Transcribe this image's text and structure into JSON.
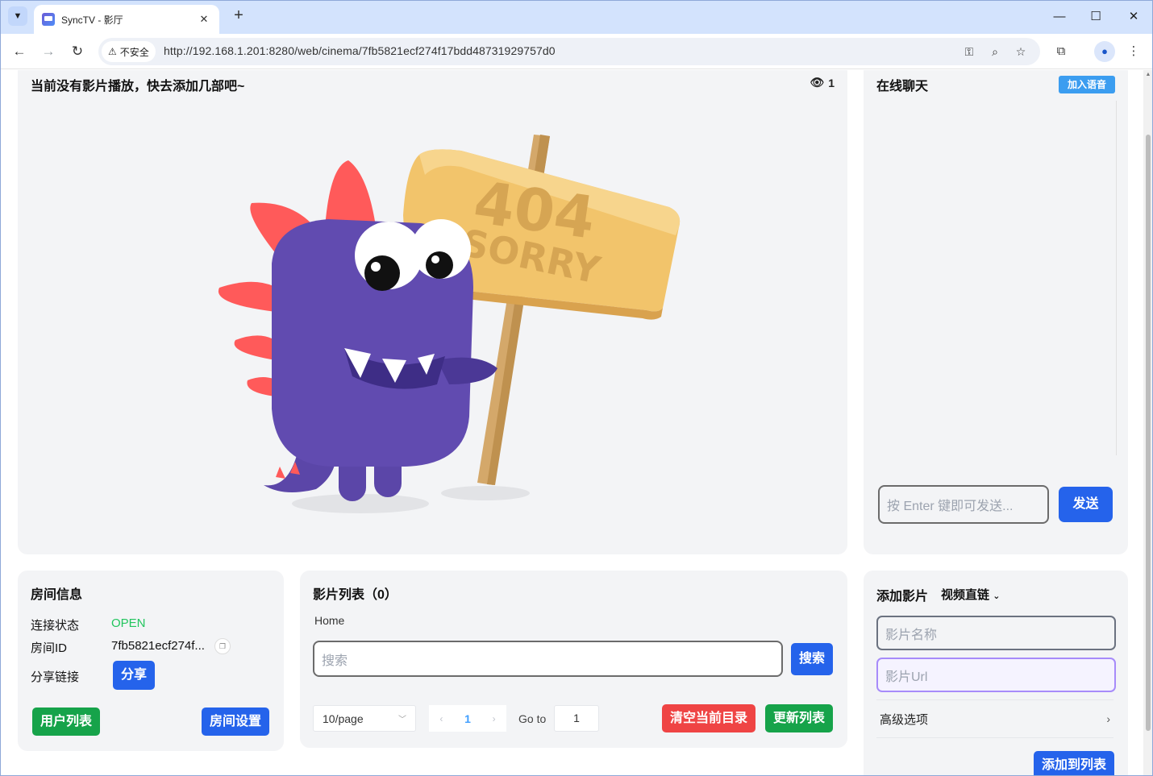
{
  "browser": {
    "tab_title": "SyncTV - 影厅",
    "security_label": "不安全",
    "url": "http://192.168.1.201:8280/web/cinema/7fb5821ecf274f17bdd48731929757d0"
  },
  "player": {
    "title": "当前没有影片播放，快去添加几部吧~",
    "viewer_count": "1",
    "sign_line1": "404",
    "sign_line2": "SORRY"
  },
  "chat": {
    "title": "在线聊天",
    "join_voice": "加入语音",
    "input_placeholder": "按 Enter 键即可发送...",
    "send": "发送"
  },
  "room": {
    "title": "房间信息",
    "status_label": "连接状态",
    "status_value": "OPEN",
    "id_label": "房间ID",
    "id_value": "7fb5821ecf274f...",
    "share_label": "分享链接",
    "share_button": "分享",
    "user_list": "用户列表",
    "room_settings": "房间设置"
  },
  "movies": {
    "title": "影片列表（0）",
    "breadcrumb": "Home",
    "search_placeholder": "搜索",
    "search_button": "搜索",
    "page_size": "10/page",
    "current_page": "1",
    "goto_label": "Go to",
    "goto_value": "1",
    "clear_dir": "清空当前目录",
    "refresh_list": "更新列表"
  },
  "add_movie": {
    "title": "添加影片",
    "mode": "视频直链",
    "name_placeholder": "影片名称",
    "url_placeholder": "影片Url",
    "advanced": "高级选项",
    "add_button": "添加到列表"
  },
  "colors": {
    "primary": "#2563eb",
    "success": "#16a34a",
    "danger": "#ef4444",
    "open_status": "#22c55e"
  }
}
